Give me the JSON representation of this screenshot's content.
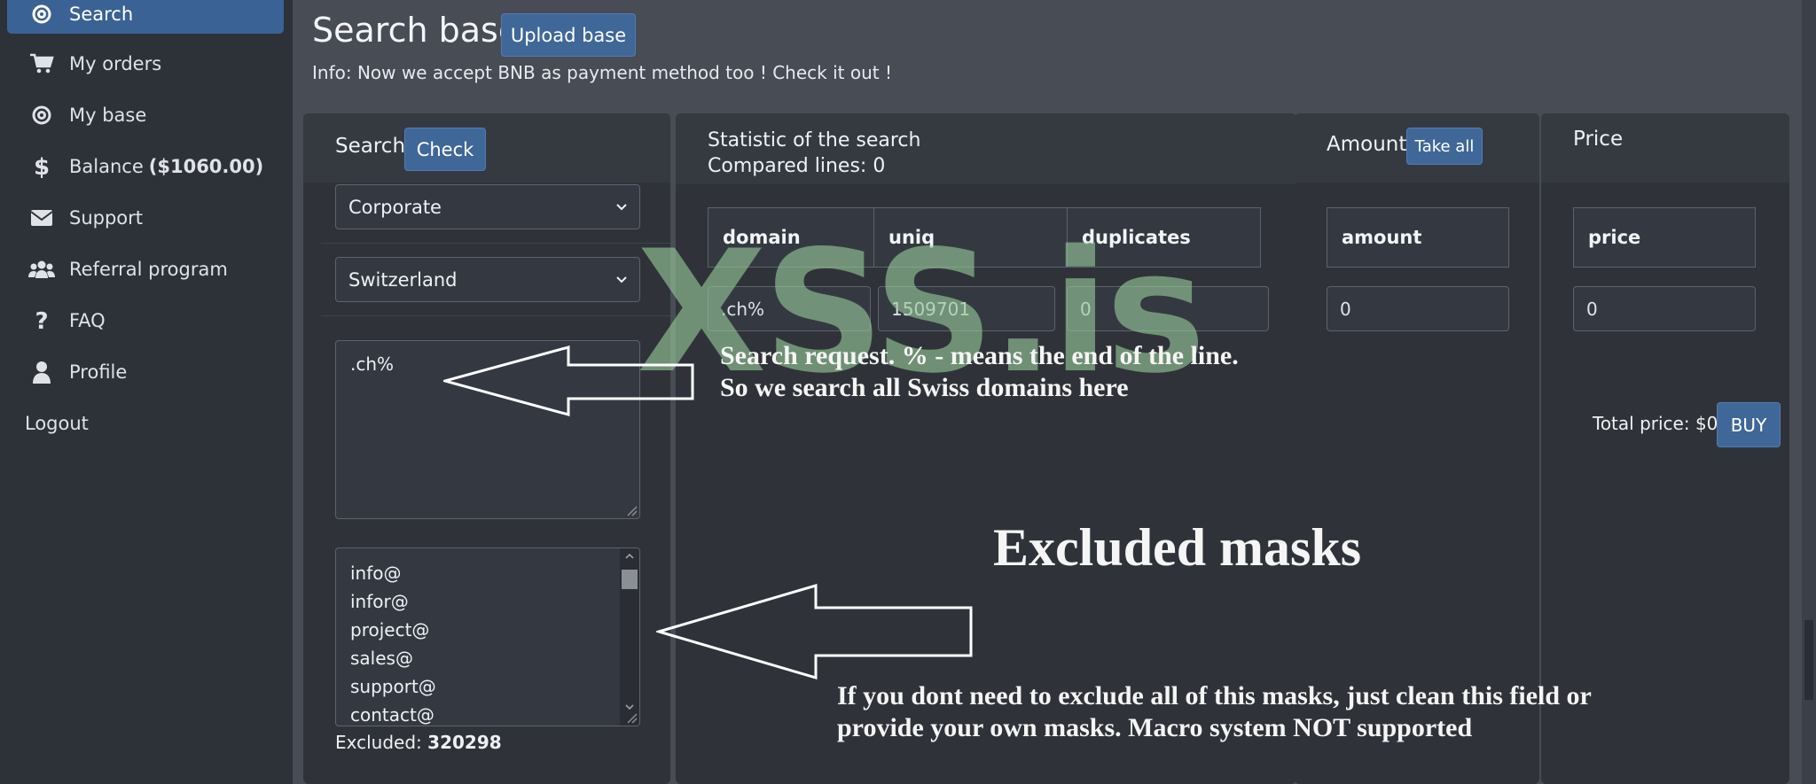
{
  "sidebar": {
    "items": [
      {
        "label": "Search",
        "icon": "at-icon",
        "active": true
      },
      {
        "label": "My orders",
        "icon": "cart-icon"
      },
      {
        "label": "My base",
        "icon": "at-icon"
      },
      {
        "label": "Balance",
        "icon": "dollar-icon",
        "extra": "($1060.00)"
      },
      {
        "label": "Support",
        "icon": "envelope-icon"
      },
      {
        "label": "Referral program",
        "icon": "users-icon"
      },
      {
        "label": "FAQ",
        "icon": "question-icon"
      },
      {
        "label": "Profile",
        "icon": "user-icon"
      },
      {
        "label": "Logout"
      }
    ]
  },
  "header": {
    "title": "Search base",
    "upload_label": "Upload base",
    "info": "Info: Now we accept BNB as payment method too ! Check it out !"
  },
  "search_panel": {
    "label": "Search",
    "check_label": "Check",
    "type_select": "Corporate",
    "country_select": "Switzerland",
    "query": ".ch%",
    "masks": [
      "info@",
      "infor@",
      "project@",
      "sales@",
      "support@",
      "contact@"
    ],
    "excluded_label": "Excluded:",
    "excluded_count": "320298"
  },
  "statistics": {
    "title": "Statistic of the search",
    "compared": "Compared lines: 0",
    "columns": [
      "domain",
      "uniq",
      "duplicates"
    ],
    "row": [
      ".ch%",
      "1509701",
      "0"
    ]
  },
  "amount_panel": {
    "label": "Amount",
    "take_all_label": "Take all",
    "column": "amount",
    "value": "0"
  },
  "price_panel": {
    "label": "Price",
    "column": "price",
    "value": "0",
    "total": "Total price: $0",
    "buy_label": "BUY"
  },
  "annotations": {
    "watermark": "XSS.is",
    "search_note_1": "Search request.  % - means the end of the line.",
    "search_note_2": "So we search all Swiss domains here",
    "excluded_title": "Excluded masks",
    "excluded_note_1": "If you dont need to exclude all of this masks, just clean this field or",
    "excluded_note_2": "provide your own masks. Macro system  NOT supported"
  },
  "colors": {
    "accent": "#3f6798",
    "sidebar_bg": "#2d3138",
    "main_bg": "#474c55",
    "panel_bg": "#2f3339",
    "watermark": "#97c99b"
  }
}
